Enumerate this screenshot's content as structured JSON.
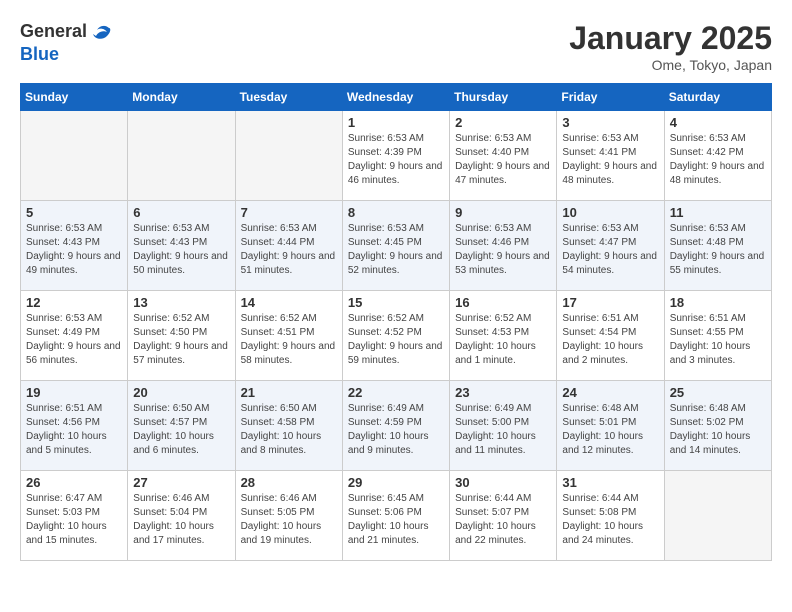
{
  "header": {
    "logo_line1": "General",
    "logo_line2": "Blue",
    "month_title": "January 2025",
    "location": "Ome, Tokyo, Japan"
  },
  "weekdays": [
    "Sunday",
    "Monday",
    "Tuesday",
    "Wednesday",
    "Thursday",
    "Friday",
    "Saturday"
  ],
  "weeks": [
    [
      {
        "day": "",
        "info": ""
      },
      {
        "day": "",
        "info": ""
      },
      {
        "day": "",
        "info": ""
      },
      {
        "day": "1",
        "info": "Sunrise: 6:53 AM\nSunset: 4:39 PM\nDaylight: 9 hours and 46 minutes."
      },
      {
        "day": "2",
        "info": "Sunrise: 6:53 AM\nSunset: 4:40 PM\nDaylight: 9 hours and 47 minutes."
      },
      {
        "day": "3",
        "info": "Sunrise: 6:53 AM\nSunset: 4:41 PM\nDaylight: 9 hours and 48 minutes."
      },
      {
        "day": "4",
        "info": "Sunrise: 6:53 AM\nSunset: 4:42 PM\nDaylight: 9 hours and 48 minutes."
      }
    ],
    [
      {
        "day": "5",
        "info": "Sunrise: 6:53 AM\nSunset: 4:43 PM\nDaylight: 9 hours and 49 minutes."
      },
      {
        "day": "6",
        "info": "Sunrise: 6:53 AM\nSunset: 4:43 PM\nDaylight: 9 hours and 50 minutes."
      },
      {
        "day": "7",
        "info": "Sunrise: 6:53 AM\nSunset: 4:44 PM\nDaylight: 9 hours and 51 minutes."
      },
      {
        "day": "8",
        "info": "Sunrise: 6:53 AM\nSunset: 4:45 PM\nDaylight: 9 hours and 52 minutes."
      },
      {
        "day": "9",
        "info": "Sunrise: 6:53 AM\nSunset: 4:46 PM\nDaylight: 9 hours and 53 minutes."
      },
      {
        "day": "10",
        "info": "Sunrise: 6:53 AM\nSunset: 4:47 PM\nDaylight: 9 hours and 54 minutes."
      },
      {
        "day": "11",
        "info": "Sunrise: 6:53 AM\nSunset: 4:48 PM\nDaylight: 9 hours and 55 minutes."
      }
    ],
    [
      {
        "day": "12",
        "info": "Sunrise: 6:53 AM\nSunset: 4:49 PM\nDaylight: 9 hours and 56 minutes."
      },
      {
        "day": "13",
        "info": "Sunrise: 6:52 AM\nSunset: 4:50 PM\nDaylight: 9 hours and 57 minutes."
      },
      {
        "day": "14",
        "info": "Sunrise: 6:52 AM\nSunset: 4:51 PM\nDaylight: 9 hours and 58 minutes."
      },
      {
        "day": "15",
        "info": "Sunrise: 6:52 AM\nSunset: 4:52 PM\nDaylight: 9 hours and 59 minutes."
      },
      {
        "day": "16",
        "info": "Sunrise: 6:52 AM\nSunset: 4:53 PM\nDaylight: 10 hours and 1 minute."
      },
      {
        "day": "17",
        "info": "Sunrise: 6:51 AM\nSunset: 4:54 PM\nDaylight: 10 hours and 2 minutes."
      },
      {
        "day": "18",
        "info": "Sunrise: 6:51 AM\nSunset: 4:55 PM\nDaylight: 10 hours and 3 minutes."
      }
    ],
    [
      {
        "day": "19",
        "info": "Sunrise: 6:51 AM\nSunset: 4:56 PM\nDaylight: 10 hours and 5 minutes."
      },
      {
        "day": "20",
        "info": "Sunrise: 6:50 AM\nSunset: 4:57 PM\nDaylight: 10 hours and 6 minutes."
      },
      {
        "day": "21",
        "info": "Sunrise: 6:50 AM\nSunset: 4:58 PM\nDaylight: 10 hours and 8 minutes."
      },
      {
        "day": "22",
        "info": "Sunrise: 6:49 AM\nSunset: 4:59 PM\nDaylight: 10 hours and 9 minutes."
      },
      {
        "day": "23",
        "info": "Sunrise: 6:49 AM\nSunset: 5:00 PM\nDaylight: 10 hours and 11 minutes."
      },
      {
        "day": "24",
        "info": "Sunrise: 6:48 AM\nSunset: 5:01 PM\nDaylight: 10 hours and 12 minutes."
      },
      {
        "day": "25",
        "info": "Sunrise: 6:48 AM\nSunset: 5:02 PM\nDaylight: 10 hours and 14 minutes."
      }
    ],
    [
      {
        "day": "26",
        "info": "Sunrise: 6:47 AM\nSunset: 5:03 PM\nDaylight: 10 hours and 15 minutes."
      },
      {
        "day": "27",
        "info": "Sunrise: 6:46 AM\nSunset: 5:04 PM\nDaylight: 10 hours and 17 minutes."
      },
      {
        "day": "28",
        "info": "Sunrise: 6:46 AM\nSunset: 5:05 PM\nDaylight: 10 hours and 19 minutes."
      },
      {
        "day": "29",
        "info": "Sunrise: 6:45 AM\nSunset: 5:06 PM\nDaylight: 10 hours and 21 minutes."
      },
      {
        "day": "30",
        "info": "Sunrise: 6:44 AM\nSunset: 5:07 PM\nDaylight: 10 hours and 22 minutes."
      },
      {
        "day": "31",
        "info": "Sunrise: 6:44 AM\nSunset: 5:08 PM\nDaylight: 10 hours and 24 minutes."
      },
      {
        "day": "",
        "info": ""
      }
    ]
  ]
}
